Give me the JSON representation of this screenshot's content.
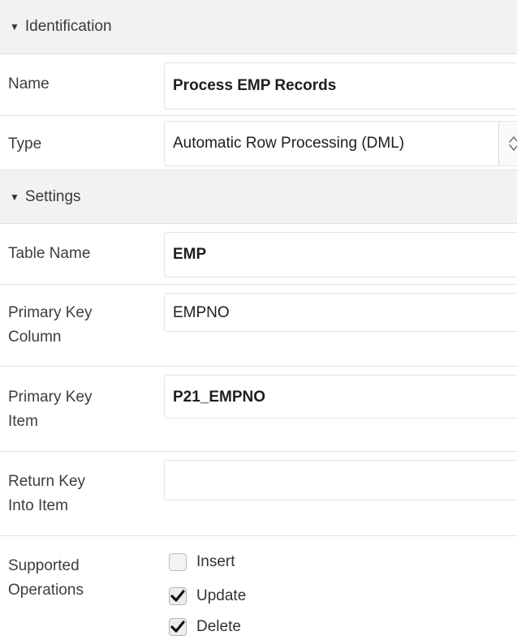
{
  "identification": {
    "header": "Identification",
    "name": {
      "label": "Name",
      "value": "Process EMP Records"
    },
    "type": {
      "label": "Type",
      "value": "Automatic Row Processing (DML)"
    }
  },
  "settings": {
    "header": "Settings",
    "table_name": {
      "label": "Table Name",
      "value": "EMP"
    },
    "primary_key_column": {
      "label_line1": "Primary Key",
      "label_line2": "Column",
      "value": "EMPNO"
    },
    "primary_key_item": {
      "label_line1": "Primary Key",
      "label_line2": "Item",
      "value": "P21_EMPNO"
    },
    "return_key_into_item": {
      "label_line1": "Return Key",
      "label_line2": "Into Item",
      "value": ""
    },
    "supported_operations": {
      "label_line1": "Supported",
      "label_line2": "Operations",
      "options": [
        {
          "label": "Insert",
          "checked": false
        },
        {
          "label": "Update",
          "checked": true
        },
        {
          "label": "Delete",
          "checked": true
        }
      ]
    }
  },
  "icons": {
    "collapse": "triangle-down-icon",
    "select_stepper": "up-down-chevron-icon",
    "checkmark": "checkmark-icon"
  }
}
